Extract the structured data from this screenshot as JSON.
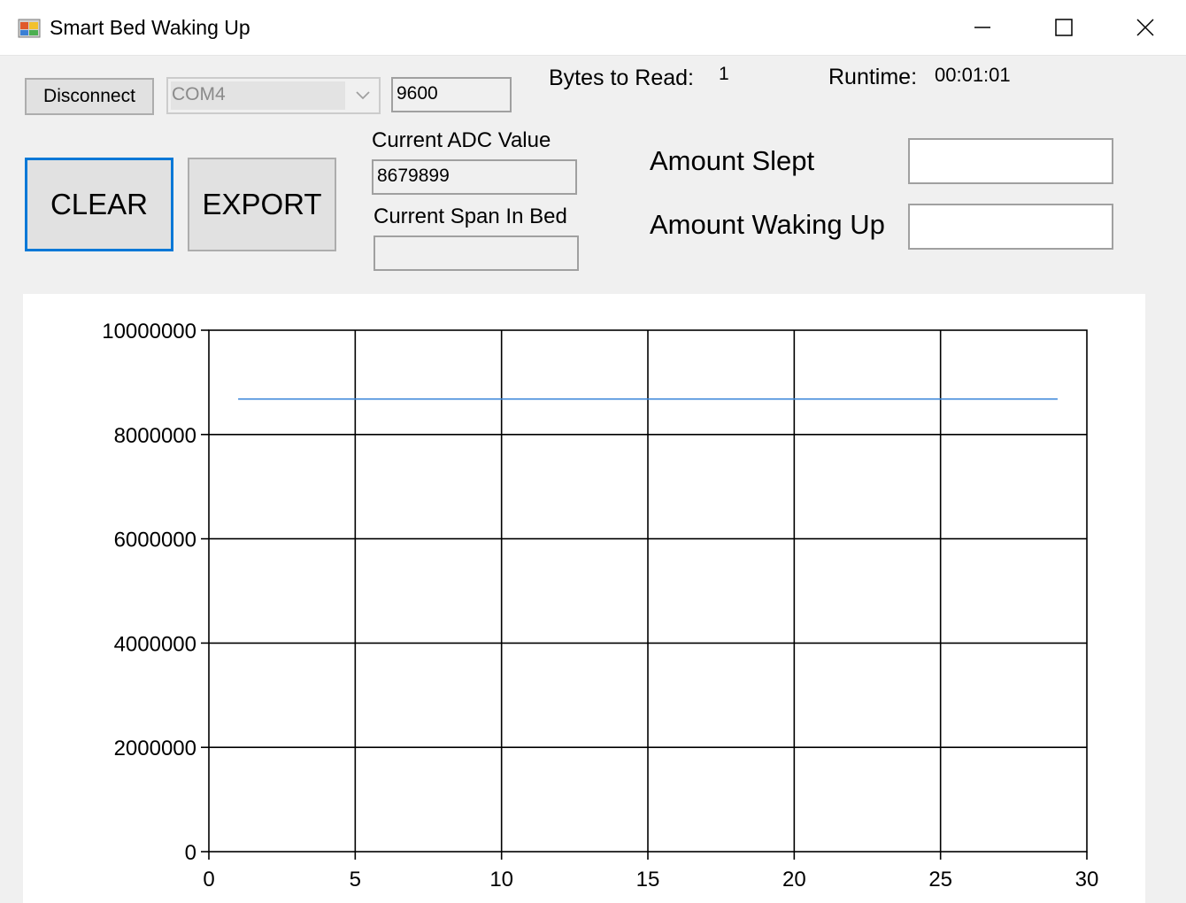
{
  "window": {
    "title": "Smart Bed Waking Up",
    "icons": {
      "app": "app-icon",
      "minimize": "minimize-icon",
      "maximize": "maximize-icon",
      "close": "close-icon"
    }
  },
  "connection": {
    "disconnect_label": "Disconnect",
    "port_value": "COM4",
    "baud_value": "9600",
    "bytes_label": "Bytes to Read:",
    "bytes_value": "1",
    "runtime_label": "Runtime:",
    "runtime_value": "00:01:01"
  },
  "actions": {
    "clear_label": "CLEAR",
    "export_label": "EXPORT"
  },
  "readings": {
    "adc_label": "Current ADC Value",
    "adc_value": "8679899",
    "span_label": "Current Span In Bed",
    "span_value": ""
  },
  "summary": {
    "slept_label": "Amount Slept",
    "slept_value": "",
    "waking_label": "Amount Waking Up",
    "waking_value": ""
  },
  "colors": {
    "series": "#3a86d9",
    "focus": "#0078d7"
  },
  "chart_data": {
    "type": "line",
    "xlim": [
      0,
      30
    ],
    "ylim": [
      0,
      10000000
    ],
    "x_ticks": [
      0,
      5,
      10,
      15,
      20,
      25,
      30
    ],
    "y_ticks": [
      0,
      2000000,
      4000000,
      6000000,
      8000000,
      10000000
    ],
    "x_tick_labels": [
      "0",
      "5",
      "10",
      "15",
      "20",
      "25",
      "30"
    ],
    "y_tick_labels": [
      "0",
      "2000000",
      "4000000",
      "6000000",
      "8000000",
      "10000000"
    ],
    "grid": true,
    "series": [
      {
        "x": [
          1,
          29
        ],
        "y": [
          8679899,
          8679899
        ]
      }
    ]
  }
}
